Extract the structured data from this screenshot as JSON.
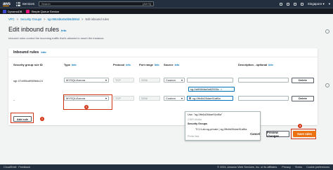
{
  "topnav": {
    "logo": "aws",
    "services_label": "Services",
    "search_placeholder": "Search",
    "search_shortcut": "[Alt+S]",
    "region": "Singapore ▾",
    "account": "▾"
  },
  "favorites": [
    {
      "label": "DynamoDB",
      "color": "#3b48cc"
    },
    {
      "label": "Simple Queue Service",
      "color": "#e7157b"
    }
  ],
  "breadcrumb": {
    "items": [
      "VPC",
      "Security Groups",
      "sg-0962d6a0a8b8d655d",
      "Edit inbound rules"
    ],
    "separator": ">"
  },
  "page": {
    "title": "Edit inbound rules",
    "info": "Info",
    "subtitle": "Inbound rules control the incoming traffic that's allowed to reach the instance."
  },
  "panel": {
    "title": "Inbound rules",
    "info": "Info",
    "columns": {
      "rule_id": "Security group rule ID",
      "type": "Type",
      "protocol": "Protocol",
      "port": "Port range",
      "source": "Source",
      "description": "Description - optional",
      "info": "Info"
    },
    "rows": [
      {
        "rule_id": "sgr-07cf89cdf969b6c24",
        "type": "MYSQL/Aurora",
        "protocol": "TCP",
        "port": "3306",
        "source": "Custom",
        "token": "sg-0a9984da3a52530c",
        "delete": "Delete"
      },
      {
        "rule_id": "–",
        "type": "MYSQL/Aurora",
        "protocol": "TCP",
        "port": "3306",
        "source": "Custom",
        "search_value": "sg-0ffc6d26dae91af6a",
        "delete": "Delete"
      }
    ],
    "add_rule": "Add rule"
  },
  "dropdown": {
    "use_option": "Use: \"sg-0ffc6d26dae91af6a\"",
    "cidr_group": "CIDR blocks",
    "sg_group": "Security Groups",
    "sg_option": "TCJ-Lab-sg-private | sg-0ffc6d26dae91af6a",
    "prefix_group": "Prefix lists"
  },
  "badges": [
    "1",
    "2",
    "3",
    "4"
  ],
  "actions": {
    "cancel": "Cancel",
    "preview": "Preview changes",
    "save": "Save rules"
  },
  "footer": {
    "cloudshell": "CloudShell",
    "feedback": "Feedback",
    "copyright": "© 2024, Amazon Web Services, Inc. or its affiliates.",
    "privacy": "Privacy",
    "terms": "Terms",
    "cookies": "Cookie preferences"
  },
  "colors": {
    "nav": "#232f3e",
    "link": "#0073bb",
    "primary": "#ec7211",
    "highlight": "#d13212"
  }
}
